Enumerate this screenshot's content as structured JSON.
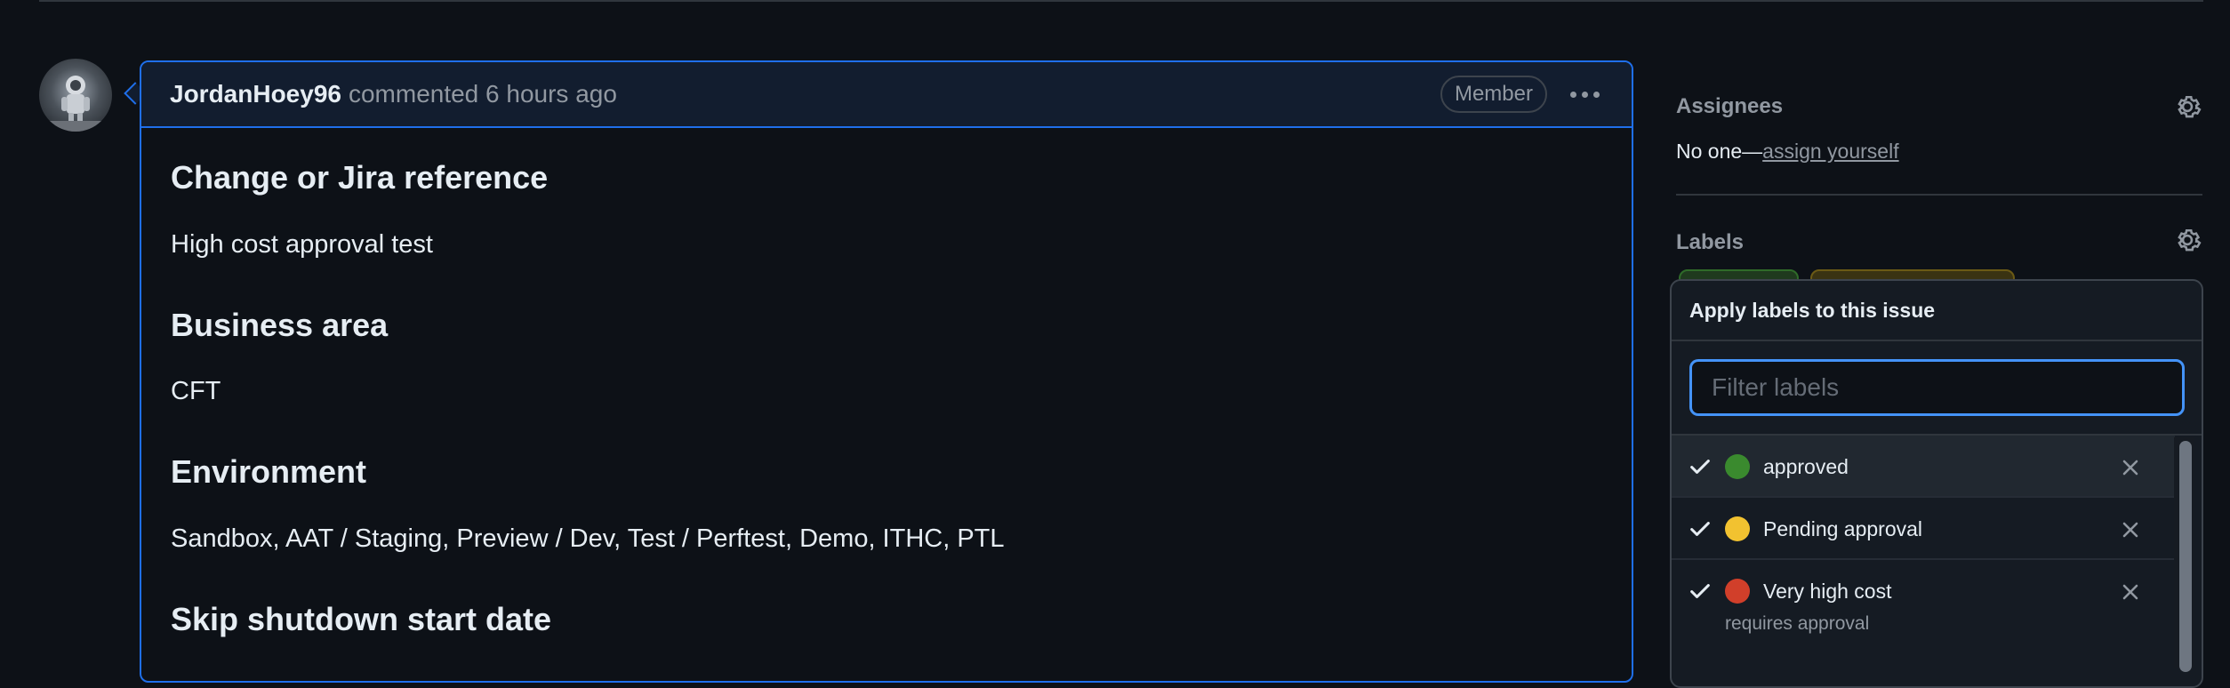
{
  "comment": {
    "author": "JordanHoey96",
    "meta": "commented 6 hours ago",
    "role_badge": "Member",
    "sections": [
      {
        "heading": "Change or Jira reference",
        "body": "High cost approval test"
      },
      {
        "heading": "Business area",
        "body": "CFT"
      },
      {
        "heading": "Environment",
        "body": "Sandbox, AAT / Staging, Preview / Dev, Test / Perftest, Demo, ITHC, PTL"
      },
      {
        "heading": "Skip shutdown start date",
        "body": ""
      }
    ]
  },
  "sidebar": {
    "assignees": {
      "heading": "Assignees",
      "none_text": "No one—",
      "assign_link": "assign yourself"
    },
    "labels": {
      "heading": "Labels"
    }
  },
  "label_menu": {
    "title": "Apply labels to this issue",
    "filter_placeholder": "Filter labels",
    "filter_value": "",
    "items": [
      {
        "name": "approved",
        "color": "#3a8a2e",
        "description": "",
        "selected": true
      },
      {
        "name": "Pending approval",
        "color": "#f2c230",
        "description": "",
        "selected": true
      },
      {
        "name": "Very high cost",
        "color": "#d13f2a",
        "description": "requires approval",
        "selected": true
      }
    ]
  },
  "colors": {
    "background": "#0d1117",
    "accent": "#1f6feb",
    "focus": "#4493f8",
    "muted_text": "#9198a1"
  },
  "icons": {
    "avatar": "astronaut-avatar",
    "settings": "gear-icon",
    "more": "kebab-horizontal-icon",
    "check": "check-icon",
    "remove": "x-icon"
  }
}
